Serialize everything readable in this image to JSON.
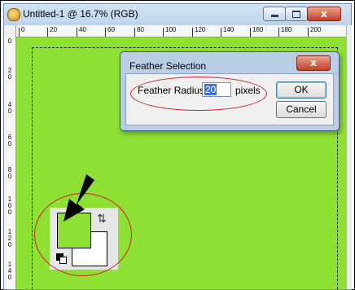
{
  "window": {
    "title": "Untitled-1 @ 16.7% (RGB)",
    "icon": "photoshop-app-icon",
    "close_label": "x"
  },
  "ruler": {
    "horizontal_labels": [
      "0",
      "20",
      "40",
      "60",
      "80",
      "100",
      "120",
      "140",
      "160",
      "180",
      "200"
    ],
    "vertical_labels": [
      "0",
      "2 0",
      "4 0",
      "6 0",
      "8 0",
      "1 0 0",
      "1 2 0",
      "1 4 0"
    ]
  },
  "canvas": {
    "fill_color": "#8ee032"
  },
  "dialog": {
    "title": "Feather Selection",
    "close_label": "x",
    "field_label": "Feather Radius:",
    "field_value": "20",
    "unit_label": "pixels",
    "ok_label": "OK",
    "cancel_label": "Cancel"
  },
  "color_swatches": {
    "foreground_color": "#8ee032",
    "background_color": "#ffffff",
    "swap_icon": "swap-arrows-icon",
    "default_icon": "default-colors-icon"
  },
  "annotations": {
    "highlight_color": "#d0202a",
    "arrow_color": "#000000"
  }
}
